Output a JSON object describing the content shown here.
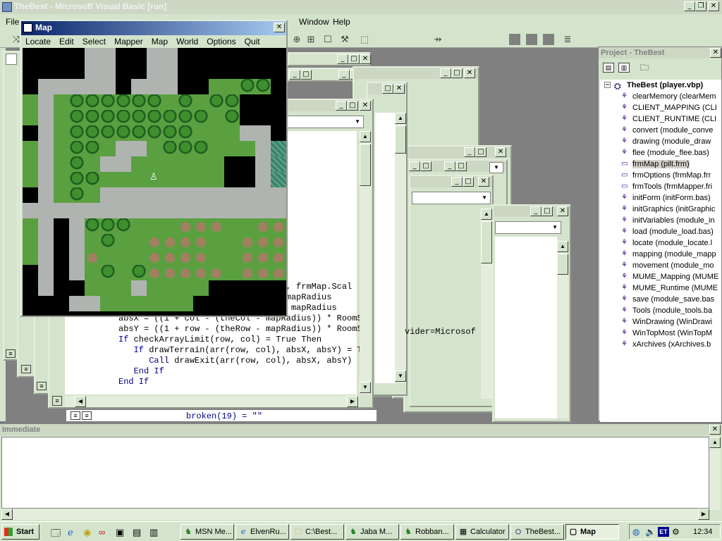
{
  "app": {
    "title": "TheBest - Microsoft Visual Basic [run]",
    "menus": [
      "File",
      "Window",
      "Help"
    ]
  },
  "map_window": {
    "title": "Map",
    "menus": [
      "Locate",
      "Edit",
      "Select",
      "Mapper",
      "Map",
      "World",
      "Options",
      "Quit"
    ]
  },
  "code_window": {
    "lines": [
      {
        "kw": "",
        "text": "                                h, frmMap.Scal"
      },
      {
        "kw": "",
        "text": "                                 mapRadius"
      },
      {
        "kw": "",
        "text": "                                + mapRadius"
      },
      {
        "kw": "",
        "text": "absX = ((1 + col - (theCol - mapRadius)) * RoomSi"
      },
      {
        "kw": "",
        "text": "absY = ((1 + row - (theRow - mapRadius)) * RoomSi"
      },
      {
        "kw": "If",
        "text": " checkArrayLimit(row, col) = True Then"
      },
      {
        "kw": "   If",
        "text": " drawTerrain(arr(row, col), absX, absY) = Tr"
      },
      {
        "kw": "      Call",
        "text": " drawExit(arr(row, col), absX, absY)"
      },
      {
        "kw": "   End If",
        "text": ""
      },
      {
        "kw": "End If",
        "text": ""
      }
    ],
    "fragment_provider": "vider=Microsof",
    "fragment_broken": "broken(19) = \"\""
  },
  "project": {
    "title": "Project - TheBest",
    "root": "TheBest (player.vbp)",
    "items": [
      {
        "label": "clearMemory (clearMem",
        "icon": "module"
      },
      {
        "label": "CLIENT_MAPPING (CLI",
        "icon": "module"
      },
      {
        "label": "CLIENT_RUNTIME (CLI",
        "icon": "module"
      },
      {
        "label": "convert (module_conve",
        "icon": "module"
      },
      {
        "label": "drawing (module_draw",
        "icon": "module"
      },
      {
        "label": "flee (module_flee.bas)",
        "icon": "module"
      },
      {
        "label": "frmMap (pilt.frm)",
        "icon": "form",
        "selected": true
      },
      {
        "label": "frmOptions (frmMap.frr",
        "icon": "form"
      },
      {
        "label": "frmTools (frmMapper.fri",
        "icon": "form"
      },
      {
        "label": "initForm (initForm.bas)",
        "icon": "module"
      },
      {
        "label": "initGraphics (initGraphic",
        "icon": "module"
      },
      {
        "label": "initVariables (module_in",
        "icon": "module"
      },
      {
        "label": "load (module_load.bas)",
        "icon": "module"
      },
      {
        "label": "locate (module_locate.l",
        "icon": "module"
      },
      {
        "label": "mapping (module_mapp",
        "icon": "module"
      },
      {
        "label": "movement (module_mo",
        "icon": "module"
      },
      {
        "label": "MUME_Mapping (MUME",
        "icon": "module"
      },
      {
        "label": "MUME_Runtime (MUME",
        "icon": "module"
      },
      {
        "label": "save (module_save.bas",
        "icon": "module"
      },
      {
        "label": "Tools (module_tools.ba",
        "icon": "module"
      },
      {
        "label": "WinDrawing (WinDrawi",
        "icon": "module"
      },
      {
        "label": "WinTopMost (WinTopM",
        "icon": "module"
      },
      {
        "label": "xArchives (xArchives.b",
        "icon": "module"
      }
    ]
  },
  "immediate": {
    "title": "Immediate"
  },
  "taskbar": {
    "start": "Start",
    "tasks": [
      "MSN Me...",
      "ElvenRu...",
      "C:\\Best...",
      "Jaba M...",
      "Robban...",
      "Calculator",
      "TheBest...",
      "Map"
    ],
    "clock": "12:34",
    "lang": "ET"
  },
  "colors": {
    "title_active": "#0a246a",
    "window_face": "#d4e4cc",
    "desktop": "#808080"
  }
}
